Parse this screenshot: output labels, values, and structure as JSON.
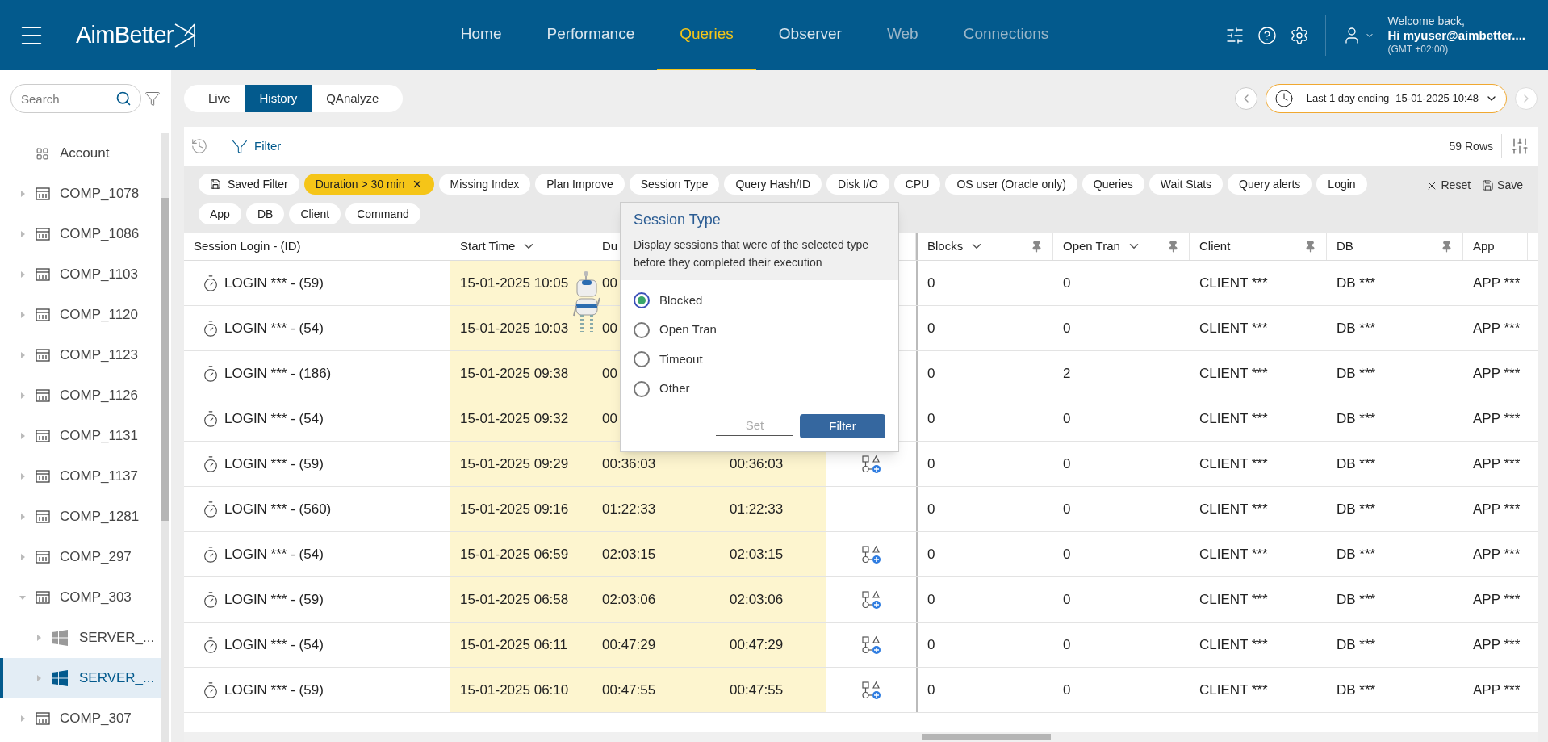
{
  "header": {
    "logo": "AimBetter",
    "nav": [
      {
        "label": "Home",
        "selected": false,
        "disabled": false
      },
      {
        "label": "Performance",
        "selected": false,
        "disabled": false
      },
      {
        "label": "Queries",
        "selected": true,
        "disabled": false
      },
      {
        "label": "Observer",
        "selected": false,
        "disabled": false
      },
      {
        "label": "Web",
        "selected": false,
        "disabled": true
      },
      {
        "label": "Connections",
        "selected": false,
        "disabled": true
      }
    ],
    "user": {
      "greeting": "Welcome back,",
      "name": "Hi myuser@aimbetter....",
      "timezone": "(GMT +02:00)"
    }
  },
  "sidebar": {
    "search": {
      "placeholder": "Search"
    },
    "tree": [
      {
        "label": "Account",
        "kind": "account"
      },
      {
        "label": "COMP_1078",
        "kind": "company",
        "expanded": false,
        "selected": false
      },
      {
        "label": "COMP_1086",
        "kind": "company",
        "expanded": false,
        "selected": false
      },
      {
        "label": "COMP_1103",
        "kind": "company",
        "expanded": false,
        "selected": false
      },
      {
        "label": "COMP_1120",
        "kind": "company",
        "expanded": false,
        "selected": false
      },
      {
        "label": "COMP_1123",
        "kind": "company",
        "expanded": false,
        "selected": false
      },
      {
        "label": "COMP_1126",
        "kind": "company",
        "expanded": false,
        "selected": false
      },
      {
        "label": "COMP_1131",
        "kind": "company",
        "expanded": false,
        "selected": false
      },
      {
        "label": "COMP_1137",
        "kind": "company",
        "expanded": false,
        "selected": false
      },
      {
        "label": "COMP_1281",
        "kind": "company",
        "expanded": false,
        "selected": false
      },
      {
        "label": "COMP_297",
        "kind": "company",
        "expanded": false,
        "selected": false
      },
      {
        "label": "COMP_303",
        "kind": "company",
        "expanded": true,
        "selected": false,
        "children": [
          {
            "label": "SERVER_...",
            "kind": "server",
            "expanded": false,
            "selected": false
          },
          {
            "label": "SERVER_...",
            "kind": "server",
            "expanded": false,
            "selected": true
          }
        ]
      },
      {
        "label": "COMP_307",
        "kind": "company",
        "expanded": false,
        "selected": false
      }
    ]
  },
  "view_tabs": [
    {
      "label": "Live",
      "selected": false
    },
    {
      "label": "History",
      "selected": true
    },
    {
      "label": "QAnalyze",
      "selected": false
    }
  ],
  "date_range": {
    "label": "Last 1 day ending",
    "value": "15-01-2025 10:48"
  },
  "toolbar": {
    "filter": "Filter",
    "row_count": "59 Rows"
  },
  "filters": [
    {
      "label": "Saved Filter",
      "kind": "saved",
      "active": false
    },
    {
      "label": "Duration > 30 min",
      "kind": "chip",
      "active": true
    },
    {
      "label": "Missing Index",
      "kind": "chip",
      "active": false
    },
    {
      "label": "Plan Improve",
      "kind": "chip",
      "active": false
    },
    {
      "label": "Session Type",
      "kind": "chip",
      "active": false
    },
    {
      "label": "Query Hash/ID",
      "kind": "chip",
      "active": false
    },
    {
      "label": "Disk I/O",
      "kind": "chip",
      "active": false
    },
    {
      "label": "CPU",
      "kind": "chip",
      "active": false
    },
    {
      "label": "OS user (Oracle only)",
      "kind": "chip",
      "active": false
    },
    {
      "label": "Queries",
      "kind": "chip",
      "active": false
    },
    {
      "label": "Wait Stats",
      "kind": "chip",
      "active": false
    },
    {
      "label": "Query alerts",
      "kind": "chip",
      "active": false
    },
    {
      "label": "Login",
      "kind": "chip",
      "active": false
    },
    {
      "label": "App",
      "kind": "chip",
      "active": false
    },
    {
      "label": "DB",
      "kind": "chip",
      "active": false
    },
    {
      "label": "Client",
      "kind": "chip",
      "active": false
    },
    {
      "label": "Command",
      "kind": "chip",
      "active": false
    }
  ],
  "filter_actions": [
    "Reset",
    "Save"
  ],
  "table": {
    "columns": [
      {
        "label": "Session Login - (ID)",
        "sortable": false,
        "pinnable": false
      },
      {
        "label": "Start Time",
        "sortable": true,
        "pinnable": false
      },
      {
        "label": "Du"
      },
      {
        "label": "Blocks",
        "sortable": true,
        "pinnable": true
      },
      {
        "label": "Open Tran",
        "sortable": true,
        "pinnable": true
      },
      {
        "label": "Client",
        "sortable": false,
        "pinnable": true
      },
      {
        "label": "DB",
        "sortable": false,
        "pinnable": true
      },
      {
        "label": "App",
        "sortable": false,
        "pinnable": false
      }
    ],
    "rows": [
      {
        "session": "LOGIN *** - (59)",
        "start": "15-01-2025 10:05",
        "duration": "00",
        "blocks": "0",
        "open_tran": "0",
        "client": "CLIENT ***",
        "db": "DB ***",
        "app": "APP ***"
      },
      {
        "session": "LOGIN *** - (54)",
        "start": "15-01-2025 10:03",
        "duration": "00",
        "blocks": "0",
        "open_tran": "0",
        "client": "CLIENT ***",
        "db": "DB ***",
        "app": "APP ***"
      },
      {
        "session": "LOGIN *** - (186)",
        "start": "15-01-2025 09:38",
        "duration": "00",
        "blocks": "0",
        "open_tran": "2",
        "client": "CLIENT ***",
        "db": "DB ***",
        "app": "APP ***"
      },
      {
        "session": "LOGIN *** - (54)",
        "start": "15-01-2025 09:32",
        "duration": "00",
        "blocks": "0",
        "open_tran": "0",
        "client": "CLIENT ***",
        "db": "DB ***",
        "app": "APP ***"
      },
      {
        "session": "LOGIN *** - (59)",
        "start": "15-01-2025 09:29",
        "duration": "00:36:03",
        "column_4": "00:36:03",
        "plan": true,
        "blocks": "0",
        "open_tran": "0",
        "client": "CLIENT ***",
        "db": "DB ***",
        "app": "APP ***"
      },
      {
        "session": "LOGIN *** - (560)",
        "start": "15-01-2025 09:16",
        "duration": "01:22:33",
        "column_4": "01:22:33",
        "plan": false,
        "blocks": "0",
        "open_tran": "0",
        "client": "CLIENT ***",
        "db": "DB ***",
        "app": "APP ***"
      },
      {
        "session": "LOGIN *** - (54)",
        "start": "15-01-2025 06:59",
        "duration": "02:03:15",
        "column_4": "02:03:15",
        "plan": true,
        "blocks": "0",
        "open_tran": "0",
        "client": "CLIENT ***",
        "db": "DB ***",
        "app": "APP ***"
      },
      {
        "session": "LOGIN *** - (59)",
        "start": "15-01-2025 06:58",
        "duration": "02:03:06",
        "column_4": "02:03:06",
        "plan": true,
        "blocks": "0",
        "open_tran": "0",
        "client": "CLIENT ***",
        "db": "DB ***",
        "app": "APP ***"
      },
      {
        "session": "LOGIN *** - (54)",
        "start": "15-01-2025 06:11",
        "duration": "00:47:29",
        "column_4": "00:47:29",
        "plan": true,
        "blocks": "0",
        "open_tran": "0",
        "client": "CLIENT ***",
        "db": "DB ***",
        "app": "APP ***"
      },
      {
        "session": "LOGIN *** - (59)",
        "start": "15-01-2025 06:10",
        "duration": "00:47:55",
        "column_4": "00:47:55",
        "plan": true,
        "blocks": "0",
        "open_tran": "0",
        "client": "CLIENT ***",
        "db": "DB ***",
        "app": "APP ***"
      }
    ]
  },
  "popup": {
    "title": "Session Type",
    "description": "Display sessions that were of the selected type before they completed their execution",
    "options": [
      {
        "label": "Blocked",
        "selected": true
      },
      {
        "label": "Open Tran",
        "selected": false
      },
      {
        "label": "Timeout",
        "selected": false
      },
      {
        "label": "Other",
        "selected": false
      }
    ],
    "set_placeholder": "Set",
    "button": "Filter"
  }
}
